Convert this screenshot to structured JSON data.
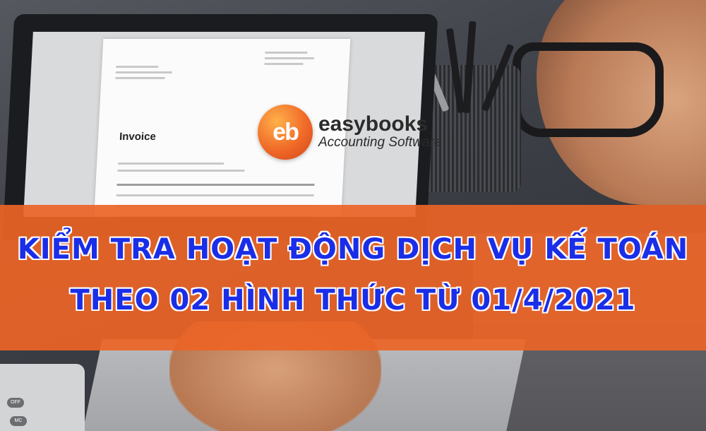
{
  "photo": {
    "screen_document_title": "Invoice"
  },
  "logo": {
    "short": "eb",
    "name": "easybooks",
    "tagline": "Accounting Software"
  },
  "banner": {
    "line1": "KIỂM TRA HOẠT ĐỘNG DỊCH VỤ KẾ TOÁN",
    "line2": "THEO 02 HÌNH THỨC TỪ 01/4/2021",
    "background_color": "#ec6426",
    "text_color": "#1a2ee8"
  },
  "calculator": {
    "keys": [
      "OFF",
      "MC"
    ]
  }
}
